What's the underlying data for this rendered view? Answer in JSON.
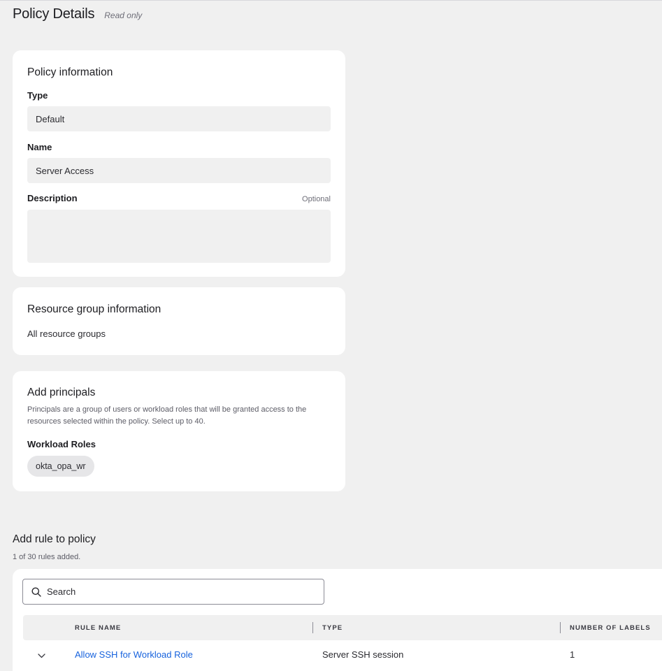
{
  "header": {
    "title": "Policy Details",
    "status": "Read only"
  },
  "policy_info": {
    "title": "Policy information",
    "type_label": "Type",
    "type_value": "Default",
    "name_label": "Name",
    "name_value": "Server Access",
    "description_label": "Description",
    "description_hint": "Optional",
    "description_value": ""
  },
  "resource_group": {
    "title": "Resource group information",
    "value": "All resource groups"
  },
  "principals": {
    "title": "Add principals",
    "help": "Principals are a group of users or workload roles that will be granted access to the resources selected within the policy. Select up to 40.",
    "workload_roles_label": "Workload Roles",
    "workload_roles": [
      "okta_opa_wr"
    ]
  },
  "rules": {
    "title": "Add rule to policy",
    "count_text": "1 of 30 rules added.",
    "search_placeholder": "Search",
    "columns": {
      "rule_name": "RULE NAME",
      "type": "TYPE",
      "number_of_labels": "NUMBER OF LABELS"
    },
    "rows": [
      {
        "rule_name": "Allow SSH for Workload Role",
        "type": "Server SSH session",
        "number_of_labels": "1"
      }
    ]
  },
  "icons": {
    "search": "search-icon",
    "expand": "chevron-down-icon"
  },
  "colors": {
    "background": "#f0f0f0",
    "card": "#ffffff",
    "link": "#1662dd",
    "text": "#1d1d21"
  }
}
